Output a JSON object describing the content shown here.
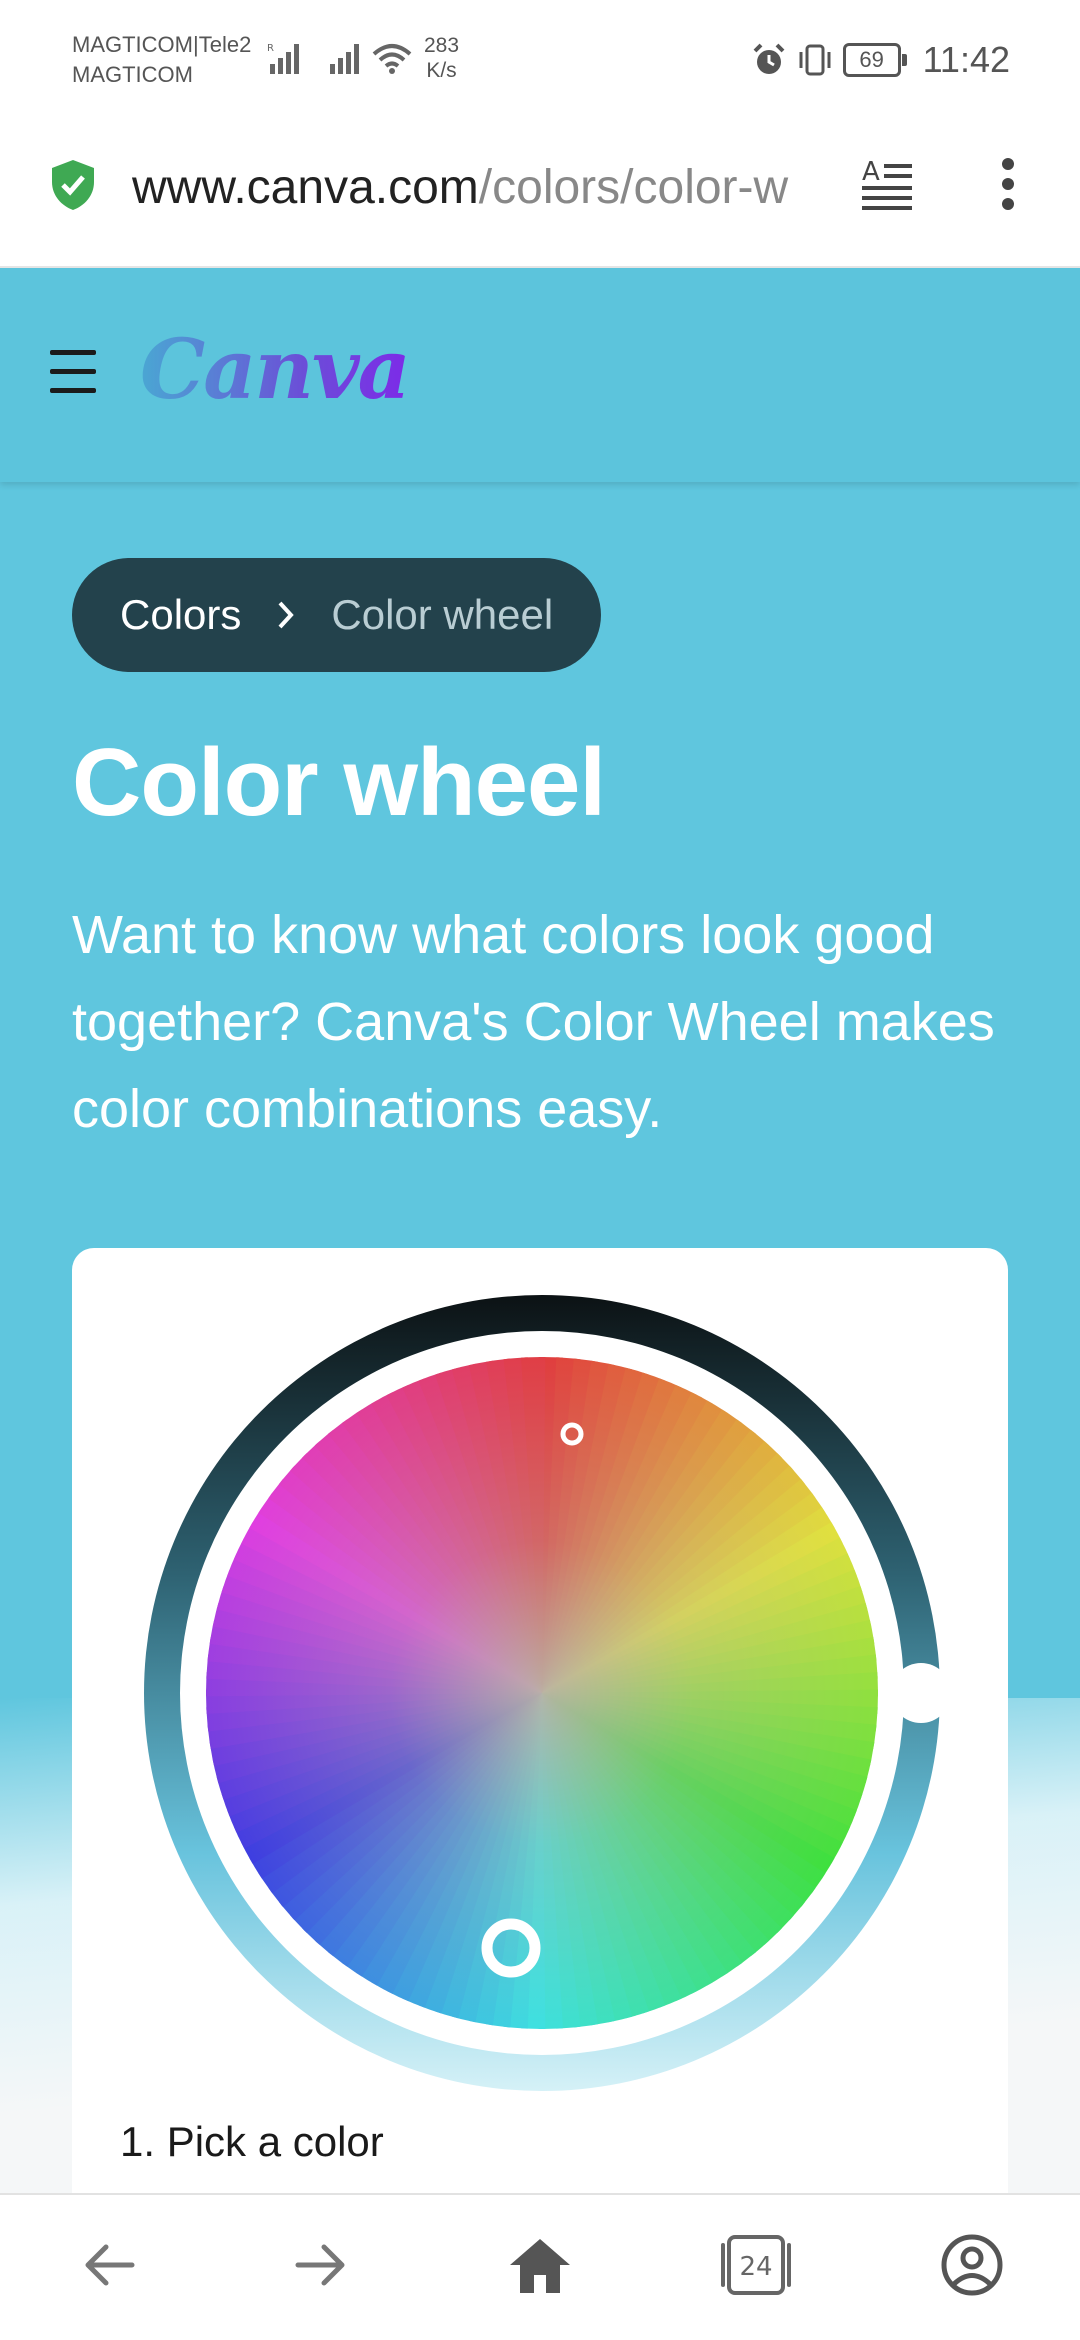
{
  "status_bar": {
    "carrier_line1": "MAGTICOM|Tele2",
    "carrier_line2": "MAGTICOM",
    "net_speed_value": "283",
    "net_speed_unit": "K/s",
    "battery": "69",
    "time": "11:42",
    "icons": [
      "signal-r-icon",
      "signal-icon",
      "wifi-icon",
      "alarm-icon",
      "vibrate-icon",
      "battery-icon"
    ]
  },
  "url_bar": {
    "domain": "www.canva.com",
    "path": "/colors/color-w",
    "secure_icon": "shield-check-icon",
    "reader_icon": "reader-mode-icon",
    "menu_icon": "more-vertical-icon"
  },
  "site_header": {
    "logo": "Canva",
    "menu_icon": "hamburger-icon"
  },
  "breadcrumb": {
    "items": [
      "Colors",
      "Color wheel"
    ],
    "separator_icon": "chevron-right-icon"
  },
  "hero": {
    "title": "Color wheel",
    "subtitle": "Want to know what colors look good together? Canva's Color Wheel makes color combinations easy."
  },
  "color_wheel_card": {
    "step_label": "1. Pick a color",
    "colors": {
      "red": "#e6392f",
      "orange": "#e39441",
      "yellow": "#d7c84a",
      "green": "#7ce35a",
      "teal": "#6ee6c2",
      "blue": "#3465dd",
      "violet": "#6a2be3",
      "magenta": "#c8379a",
      "ring_dark": "#0c1214",
      "ring_light": "#cfeef5"
    }
  },
  "bottom_nav": {
    "tab_count": "24",
    "icons": [
      "back-arrow-icon",
      "forward-arrow-icon",
      "home-icon",
      "tabs-icon",
      "account-icon"
    ]
  }
}
